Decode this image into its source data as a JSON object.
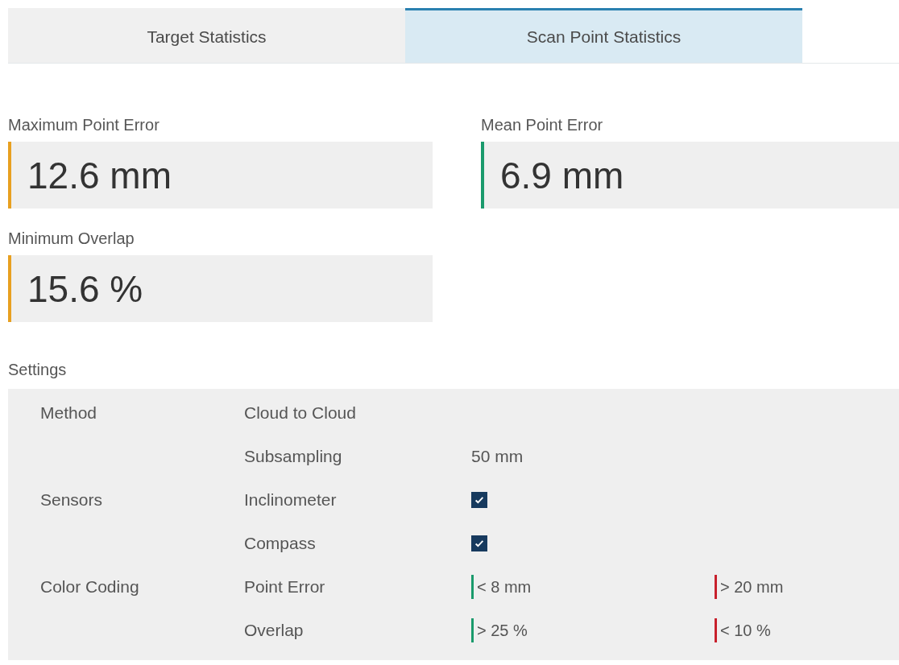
{
  "tabs": [
    {
      "label": "Target Statistics",
      "selected": false
    },
    {
      "label": "Scan Point Statistics",
      "selected": true
    }
  ],
  "metrics": [
    {
      "label": "Maximum Point Error",
      "value": "12.6 mm",
      "color": "#e8a020"
    },
    {
      "label": "Mean Point Error",
      "value": "6.9 mm",
      "color": "#1a9a6c"
    },
    {
      "label": "Minimum Overlap",
      "value": "15.6 %",
      "color": "#e8a020"
    }
  ],
  "settings": {
    "title": "Settings",
    "rows": [
      {
        "kind": "text",
        "group": "Method",
        "name": "Cloud to Cloud"
      },
      {
        "kind": "text",
        "name": "Subsampling",
        "value": "50 mm"
      },
      {
        "kind": "checkbox",
        "group": "Sensors",
        "name": "Inclinometer",
        "checked": true
      },
      {
        "kind": "checkbox",
        "name": "Compass",
        "checked": true
      },
      {
        "kind": "thresholds",
        "group": "Color Coding",
        "name": "Point Error",
        "thresholds": [
          {
            "text": "< 8 mm",
            "color": "#1a9a6c"
          },
          {
            "text": "> 20 mm",
            "color": "#c8202c"
          }
        ]
      },
      {
        "kind": "thresholds",
        "name": "Overlap",
        "thresholds": [
          {
            "text": "> 25 %",
            "color": "#1a9a6c"
          },
          {
            "text": "< 10 %",
            "color": "#c8202c"
          }
        ]
      }
    ]
  }
}
